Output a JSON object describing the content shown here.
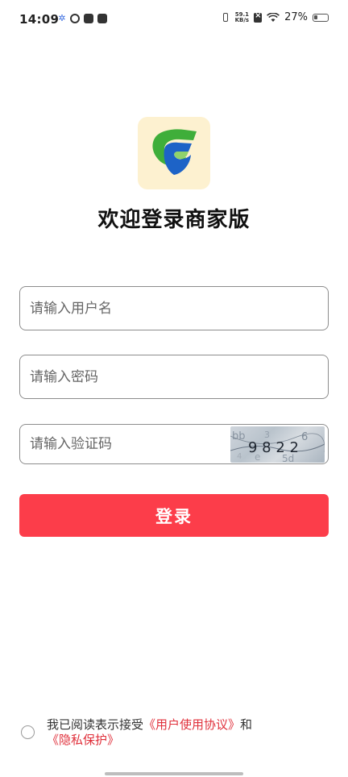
{
  "status_bar": {
    "time": "14:09",
    "net_speed_value": "59.1",
    "net_speed_unit": "KB/s",
    "battery_percent": "27%",
    "battery_level": 0.27
  },
  "page": {
    "title": "欢迎登录商家版"
  },
  "form": {
    "username_placeholder": "请输入用户名",
    "password_placeholder": "请输入密码",
    "captcha_placeholder": "请输入验证码",
    "captcha_text": "9 8 2 2",
    "login_label": "登录"
  },
  "agreement": {
    "prefix": "我已阅读表示接受",
    "user_agreement": "《用户使用协议》",
    "and": "和",
    "privacy": "《隐私保护》"
  },
  "colors": {
    "accent": "#fc3d4a",
    "link": "#e0303b"
  }
}
